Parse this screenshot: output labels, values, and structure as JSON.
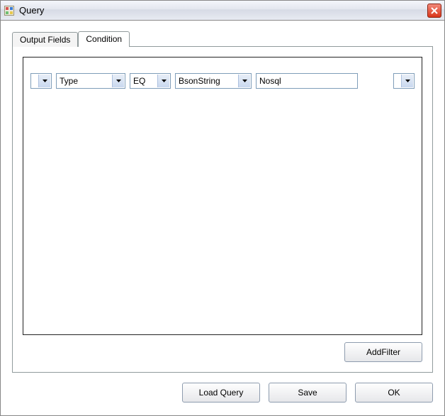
{
  "window": {
    "title": "Query"
  },
  "tabs": {
    "output_fields": {
      "label": "Output Fields"
    },
    "condition": {
      "label": "Condition"
    }
  },
  "filter_row": {
    "logic": {
      "selected": ""
    },
    "field": {
      "selected": "Type"
    },
    "operator": {
      "selected": "EQ"
    },
    "bson_type": {
      "selected": "BsonString"
    },
    "value": "Nosql",
    "trailing": {
      "selected": ""
    }
  },
  "buttons": {
    "add_filter": "AddFilter",
    "load_query": "Load Query",
    "save": "Save",
    "ok": "OK"
  }
}
